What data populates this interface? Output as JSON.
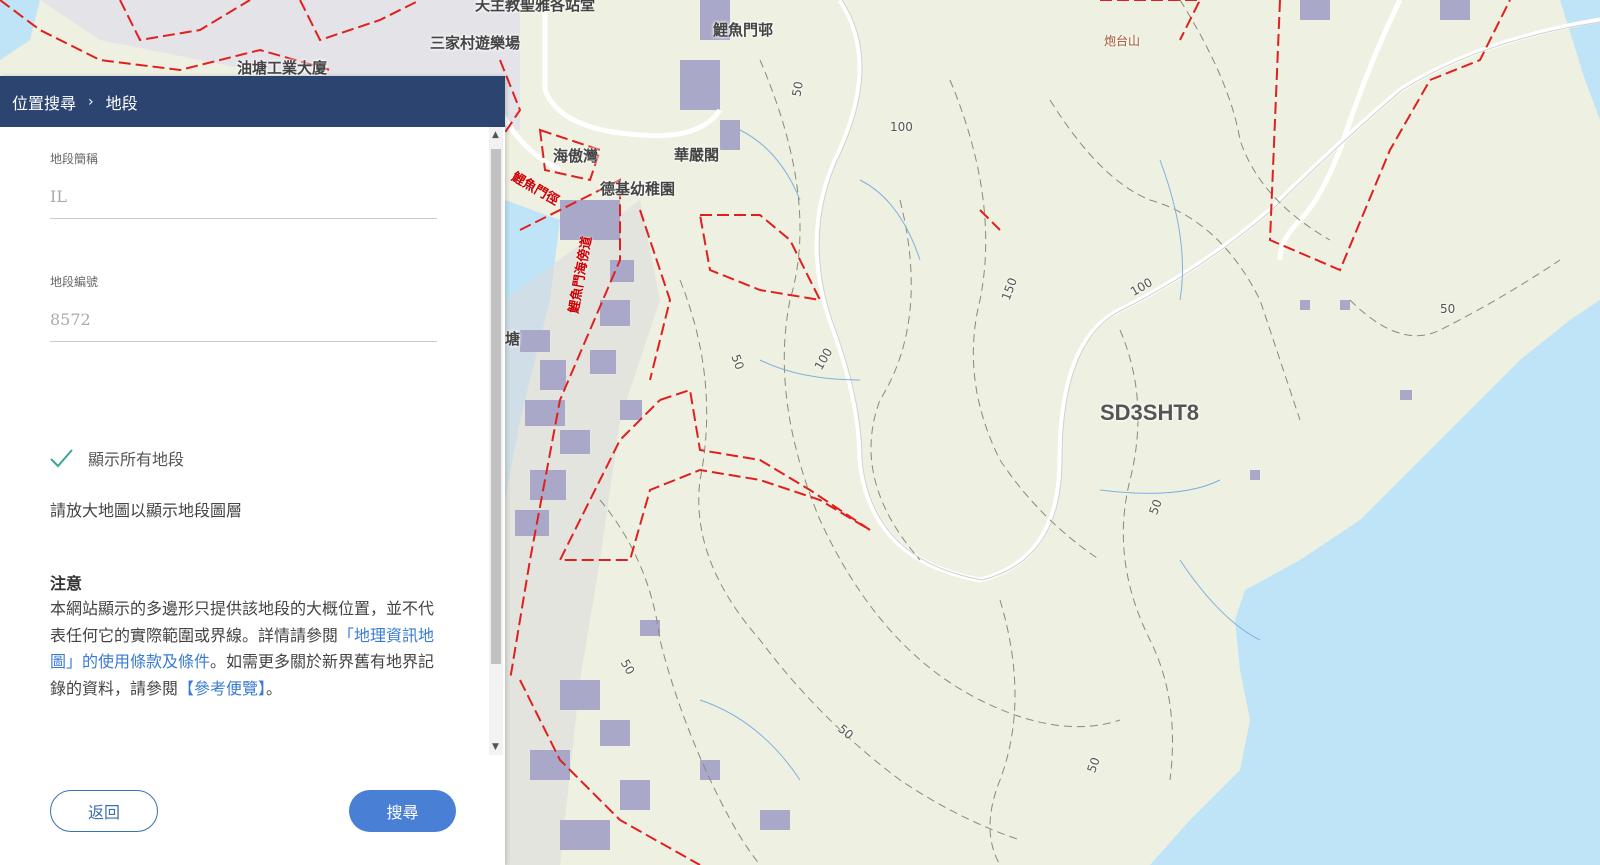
{
  "header": {
    "crumb_parent": "位置搜尋",
    "crumb_sep": "›",
    "crumb_current": "地段"
  },
  "form": {
    "lot_short_label": "地段簡稱",
    "lot_short_value": "IL",
    "lot_number_label": "地段編號",
    "lot_number_value": "8572",
    "show_all_label": "顯示所有地段",
    "show_all_checked": true,
    "zoom_hint": "請放大地圖以顯示地段圖層"
  },
  "notice": {
    "title": "注意",
    "text_part1": "本網站顯示的多邊形只提供該地段的大概位置，並不代表任何它的實際範圍或界線。詳情請參閱",
    "link1": "「地理資訊地圖」的使用條款及條件",
    "text_part2": "。如需更多關於新界舊有地界記錄的資料，請參閱",
    "link2": "【參考便覽】",
    "text_part3": "。"
  },
  "buttons": {
    "back": "返回",
    "search": "搜尋"
  },
  "map": {
    "labels": {
      "place1": "天主教聖雅各站堂",
      "place2": "三家村遊樂場",
      "place3": "鯉魚門邨",
      "place4": "油塘工業大廈",
      "place5": "炮台山",
      "place6": "海傲灣",
      "place7": "華嚴閣",
      "place8": "德基幼稚園",
      "road1": "鯉魚門徑",
      "road2": "鯉魚門海傍道",
      "place9": "塘",
      "lot_code": "SD3SHT8",
      "contour_100a": "100",
      "contour_100b": "100",
      "contour_100c": "100",
      "contour_150": "150",
      "contour_50a": "50",
      "contour_50b": "50",
      "contour_50c": "50",
      "contour_50d": "50",
      "contour_50e": "50",
      "contour_50f": "50",
      "contour_50g": "50"
    },
    "colors": {
      "land": "#eef0e1",
      "sea": "#bfe4f7",
      "building": "#a9a8c9",
      "boundary": "#e0201f",
      "road": "#ffffff"
    }
  }
}
